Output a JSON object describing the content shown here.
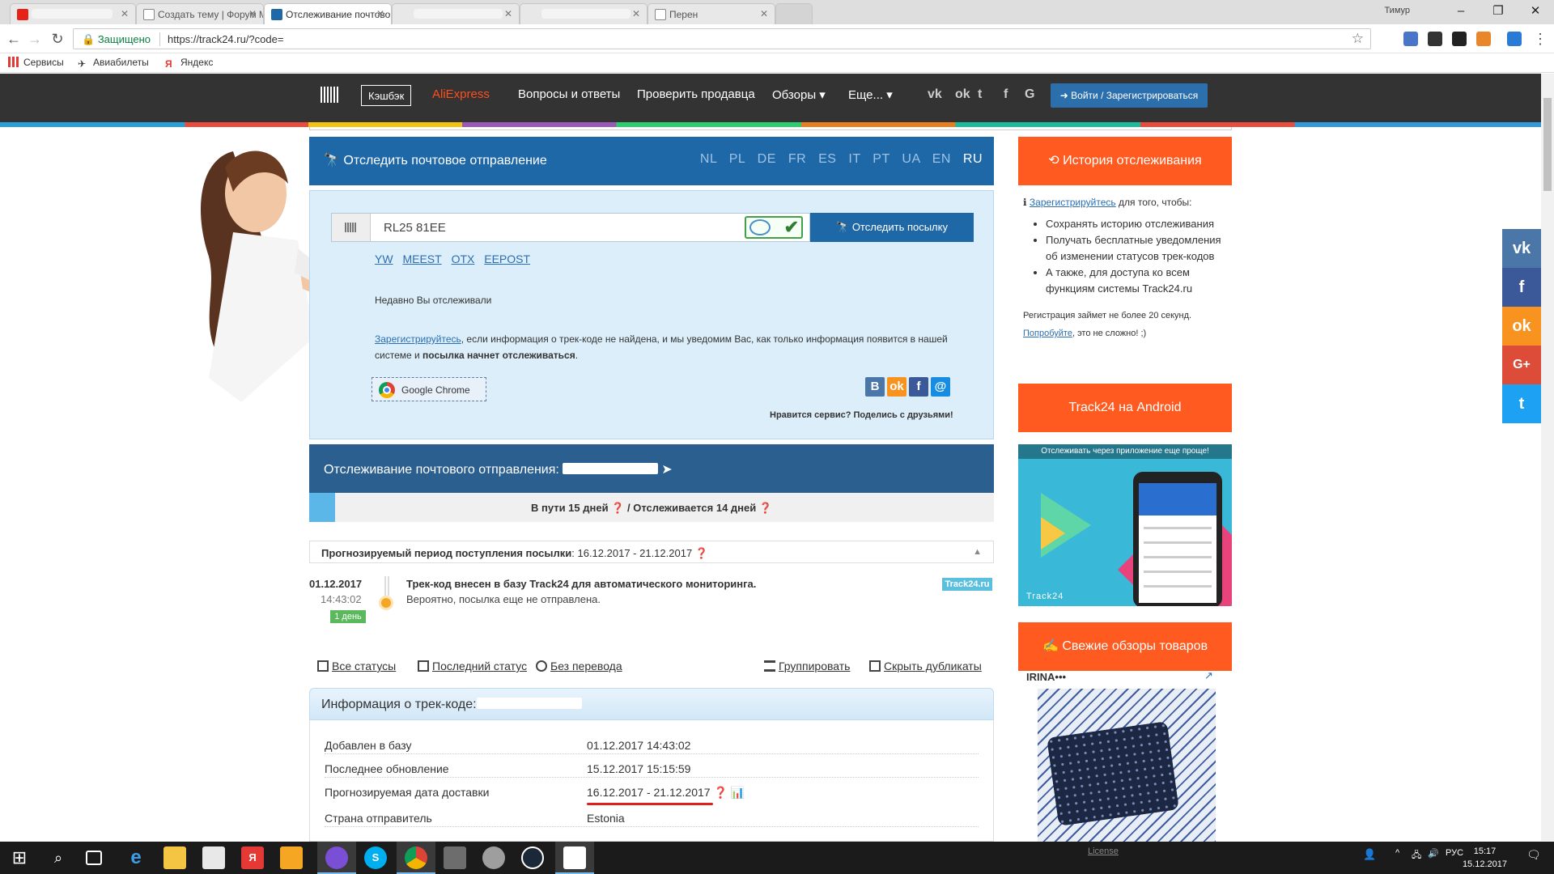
{
  "browser": {
    "tabs": [
      {
        "label": "",
        "icon": "youtube-icon"
      },
      {
        "label": "Создать тему | Форум М",
        "icon": "document-icon"
      },
      {
        "label": "Отслеживание почтово",
        "icon": "track24-icon"
      },
      {
        "label": "",
        "icon": "blank-icon"
      },
      {
        "label": "",
        "icon": "blank-icon"
      },
      {
        "label": "Перен",
        "icon": "document-icon"
      }
    ],
    "user": "Тимур",
    "secure_label": "Защищено",
    "url": "https://track24.ru/?code=",
    "bookmarks": [
      "Сервисы",
      "Авиабилеты",
      "Яндекс"
    ]
  },
  "nav": {
    "cashback": "Кэшбэк",
    "aliexpress": "AliExpress",
    "items": [
      "Вопросы и ответы",
      "Проверить продавца",
      "Обзоры ▾",
      "Еще... ▾"
    ],
    "login": "Войти / Зарегистрироваться"
  },
  "track": {
    "header": "Отследить почтовое отправление",
    "languages": [
      "NL",
      "PL",
      "DE",
      "FR",
      "ES",
      "IT",
      "PT",
      "UA",
      "EN",
      "RU"
    ],
    "current_language": "RU",
    "code_value": "RL25        81EE",
    "button": "Отследить посылку",
    "carriers": [
      "YW",
      "MEEST",
      "OTX",
      "EEPOST"
    ],
    "recent_label": "Недавно Вы отслеживали",
    "register_link": "Зарегистрируйтесь",
    "register_text": ", если информация о трек-коде не найдена, и мы уведомим Вас, как только информация появится в нашей системе и ",
    "register_bold": "посылка начнет отслеживаться",
    "chrome_button": "Google Chrome",
    "share_text": "Нравится сервис? Поделись с друзьями!"
  },
  "status": {
    "header": "Отслеживание почтового отправления:",
    "progress_text": "В пути 15 дней ❓ / Отслеживается 14 дней ❓",
    "forecast_label": "Прогнозируемый период поступления посылки",
    "forecast_value": ": 16.12.2017 - 21.12.2017 ❓",
    "event": {
      "date": "01.12.2017",
      "time": "14:43:02",
      "badge": "1 день",
      "title": "Трек-код внесен в базу Track24 для автоматического мониторинга.",
      "subtitle": "Вероятно, посылка еще не отправлена.",
      "source": "Track24.ru"
    },
    "tools": [
      "Все статусы",
      "Последний статус",
      "Без перевода",
      "Группировать",
      "Скрыть дубликаты"
    ]
  },
  "info": {
    "header": "Информация о трек-коде:",
    "rows": [
      {
        "k": "Добавлен в базу",
        "v": "01.12.2017 14:43:02"
      },
      {
        "k": "Последнее обновление",
        "v": "15.12.2017 15:15:59"
      },
      {
        "k": "Прогнозируемая дата доставки",
        "v": "16.12.2017 - 21.12.2017"
      },
      {
        "k": "Страна отправитель",
        "v": "Estonia"
      }
    ]
  },
  "sidebar": {
    "history_header": "История отслеживания",
    "history_intro_link": "Зарегистрируйтесь",
    "history_intro": " для того, чтобы:",
    "benefits": [
      "Сохранять историю отслеживания",
      "Получать бесплатные уведомления об изменении статусов трек-кодов",
      "А также, для доступа ко всем функциям системы Track24.ru"
    ],
    "reg_time": "Регистрация займет не более 20 секунд.",
    "try_link": "Попробуйте",
    "try_text": ", это не сложно! ;)",
    "android_header": "Track24 на Android",
    "android_caption": "Отслеживать через  приложение еще проще!",
    "android_logo": "Track24",
    "reviews_header": "Свежие обзоры товаров",
    "review_author": "IRINA•••"
  },
  "taskbar": {
    "lang": "РУС",
    "time": "15:17",
    "date": "15.12.2017",
    "license": "License"
  },
  "colors": {
    "brand_blue": "#1f68a8",
    "orange": "#ff5a1f",
    "nav_dark": "#333333"
  }
}
